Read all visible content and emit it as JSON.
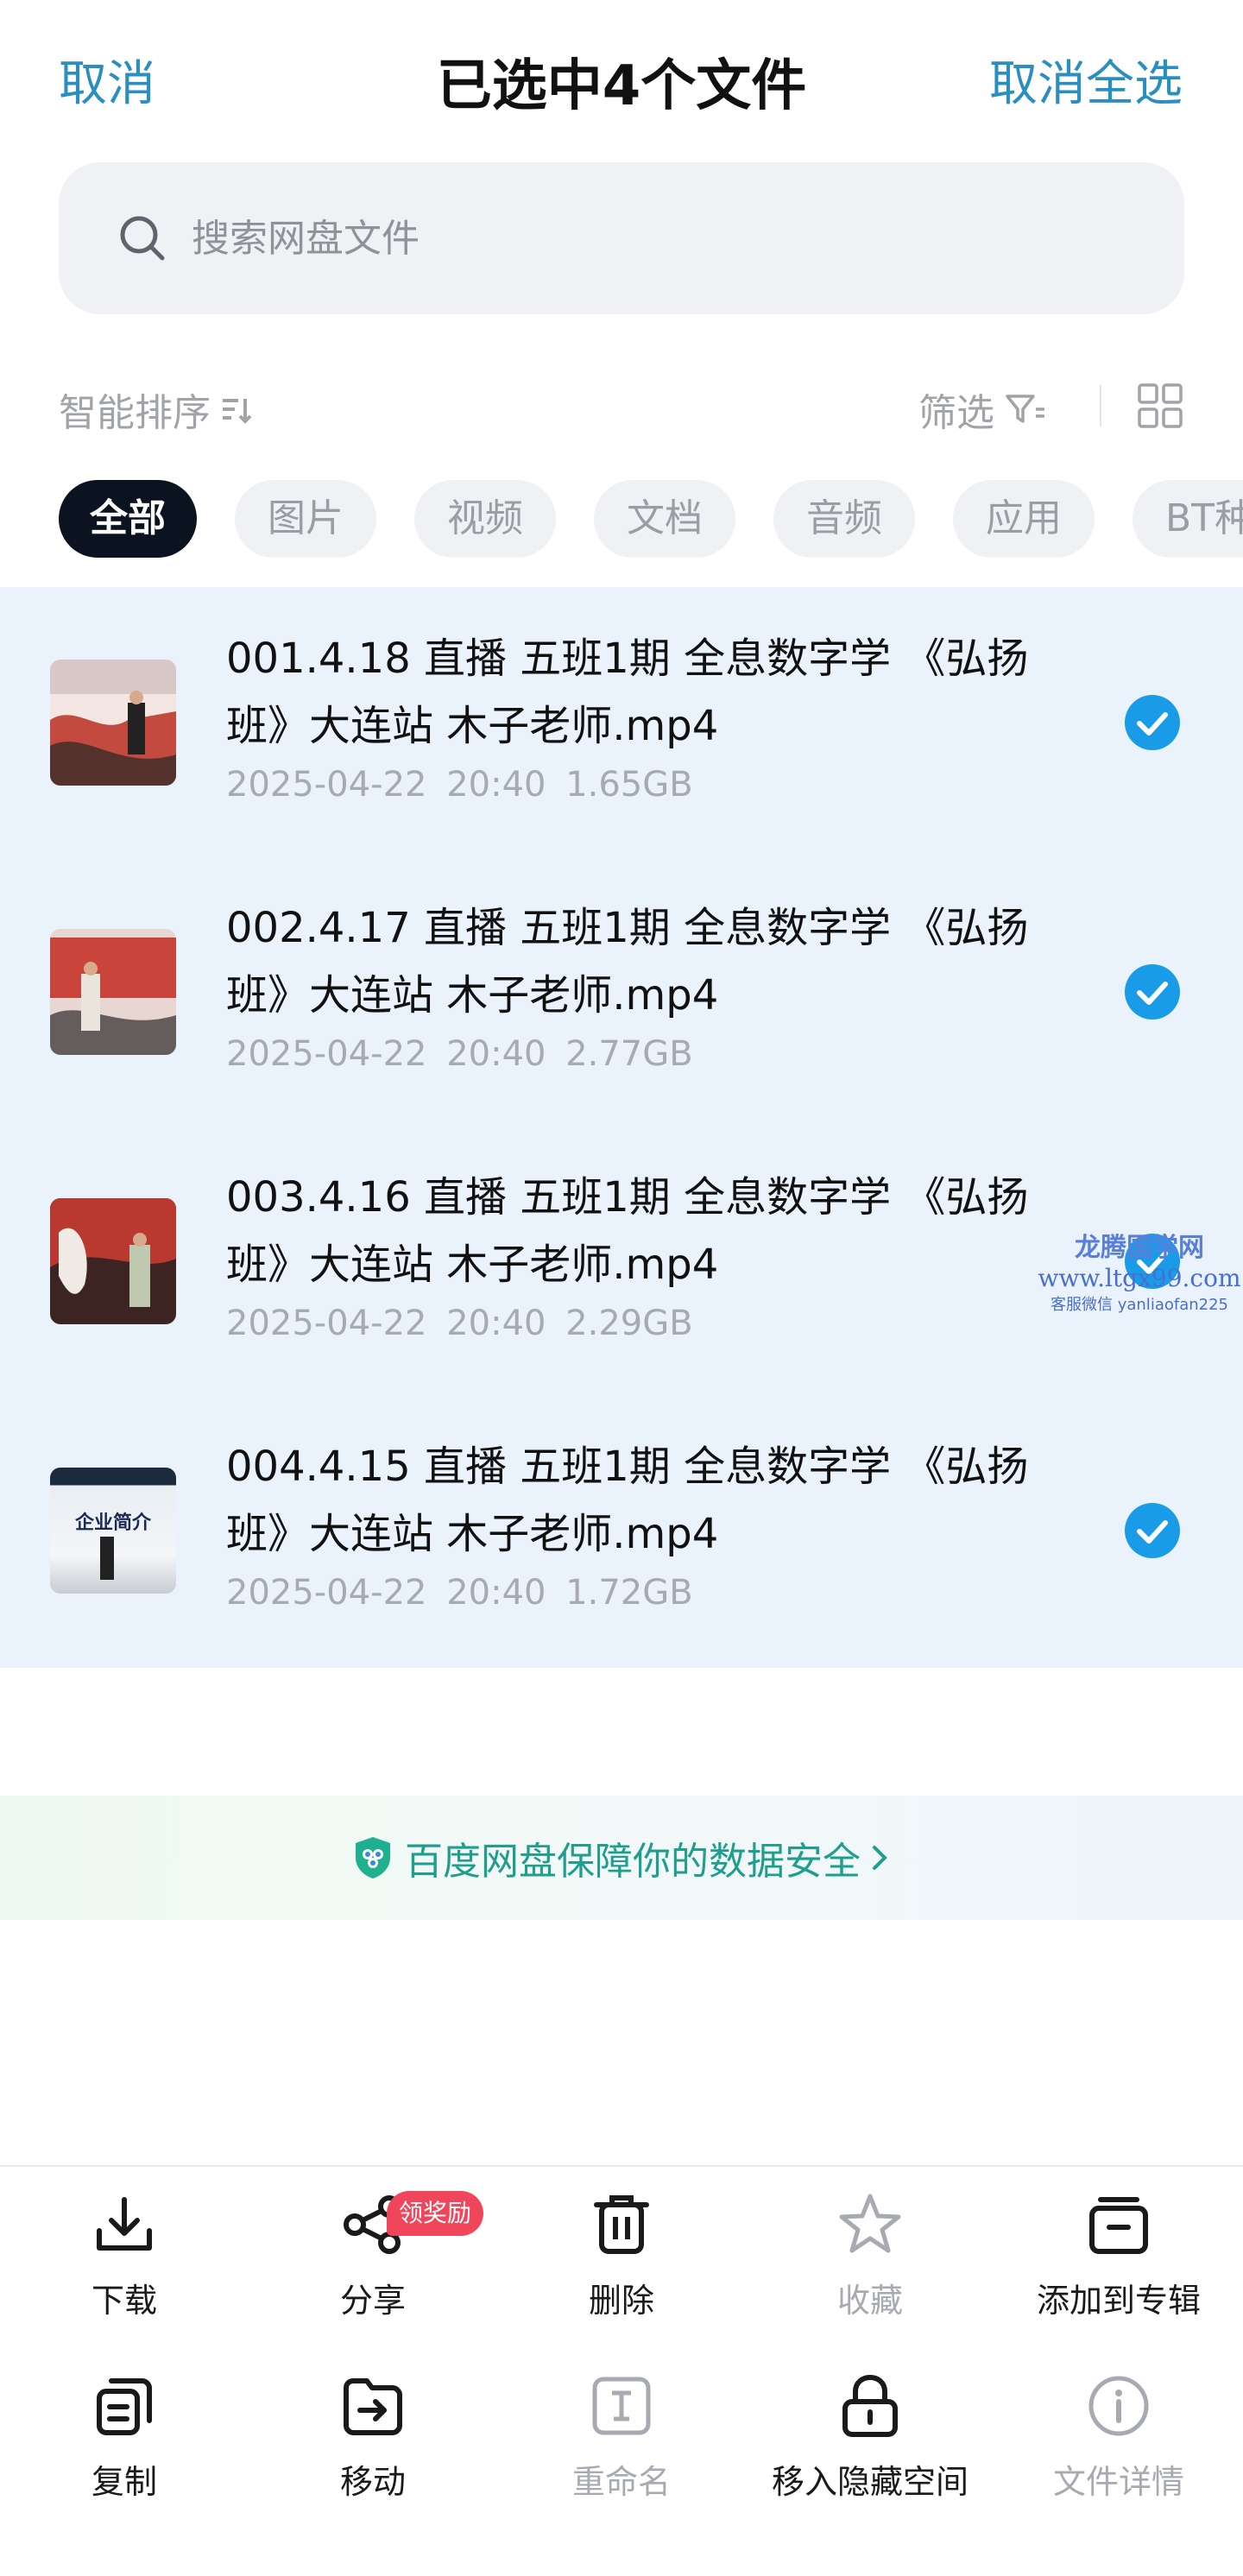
{
  "header": {
    "cancel_label": "取消",
    "title": "已选中4个文件",
    "deselect_all_label": "取消全选"
  },
  "search": {
    "placeholder": "搜索网盘文件",
    "icon": "search-icon"
  },
  "toolbar": {
    "sort_label": "智能排序",
    "sort_icon": "sort-icon",
    "filter_label": "筛选",
    "filter_icon": "filter-icon",
    "view_icon": "grid-view-icon"
  },
  "categories": {
    "active": "全部",
    "items": [
      "全部",
      "图片",
      "视频",
      "文档",
      "音频",
      "应用",
      "BT种"
    ]
  },
  "files": [
    {
      "name": "001.4.18 直播 五班1期 全息数字学 《弘扬班》大连站 木子老师.mp4",
      "date": "2025-04-22",
      "time": "20:40",
      "size": "1.65GB",
      "selected": true
    },
    {
      "name": "002.4.17 直播 五班1期 全息数字学 《弘扬班》大连站 木子老师.mp4",
      "date": "2025-04-22",
      "time": "20:40",
      "size": "2.77GB",
      "selected": true
    },
    {
      "name": "003.4.16 直播 五班1期 全息数字学 《弘扬班》大连站 木子老师.mp4",
      "date": "2025-04-22",
      "time": "20:40",
      "size": "2.29GB",
      "selected": true
    },
    {
      "name": "004.4.15 直播 五班1期 全息数字学 《弘扬班》大连站 木子老师.mp4",
      "date": "2025-04-22",
      "time": "20:40",
      "size": "1.72GB",
      "selected": true
    }
  ],
  "thumbnails": {
    "thumb4_text": "企业简介"
  },
  "watermark": {
    "line1": "龙腾国学网",
    "line2": "www.ltgx99.com",
    "line3": "客服微信 yanliaofan225"
  },
  "banner": {
    "text": "百度网盘保障你的数据安全",
    "icon": "shield-icon"
  },
  "actions": {
    "download": "下载",
    "share": "分享",
    "share_badge": "领奖励",
    "delete": "删除",
    "favorite": "收藏",
    "add_to_album": "添加到专辑",
    "copy": "复制",
    "move": "移动",
    "rename": "重命名",
    "move_to_hidden": "移入隐藏空间",
    "file_details": "文件详情"
  },
  "colors": {
    "accent": "#2a8fc0",
    "check": "#1a9be8",
    "selected_bg": "#eaf3fc",
    "badge": "#f0455a",
    "banner_text": "#1f9e8e"
  }
}
